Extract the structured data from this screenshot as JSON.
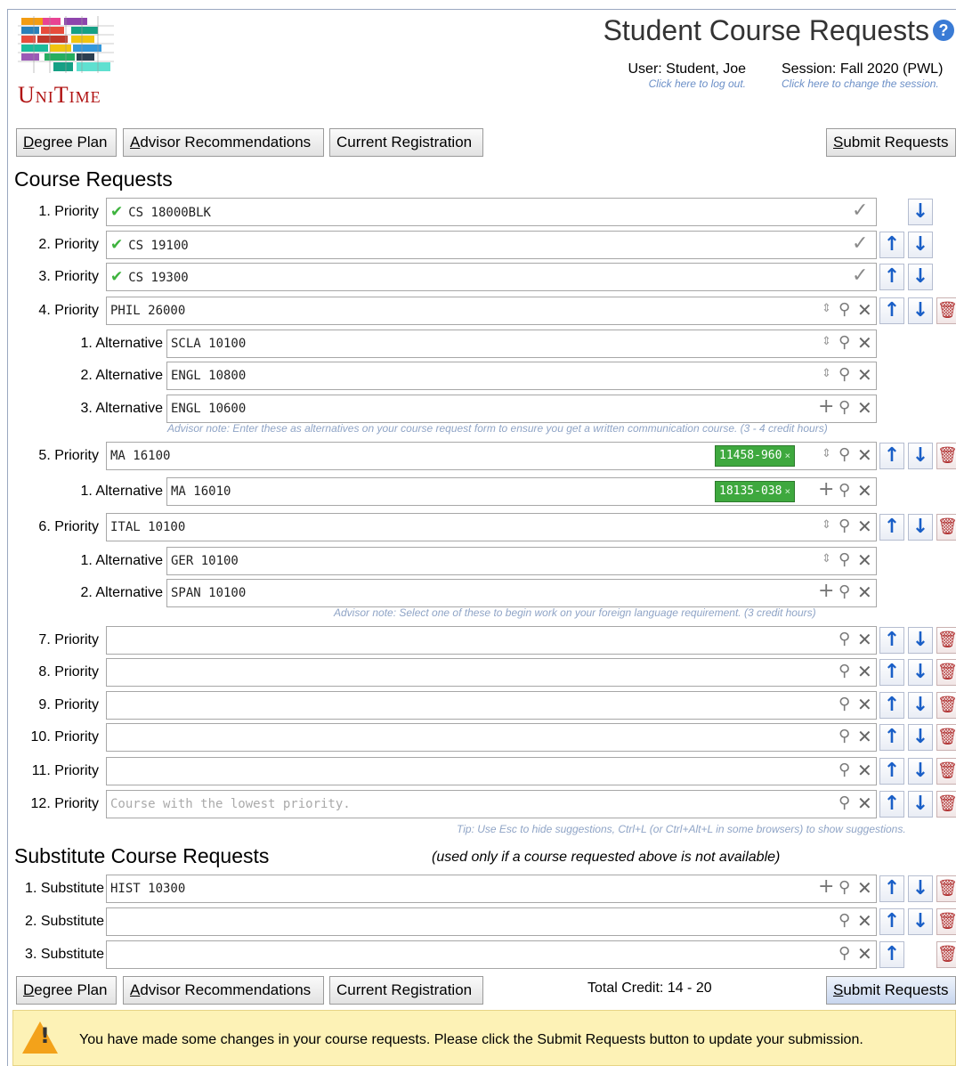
{
  "app": {
    "logo_text": "UniTime",
    "title": "Student Course Requests"
  },
  "header": {
    "user_label": "User: Student, Joe",
    "user_sub": "Click here to log out.",
    "session_label": "Session: Fall 2020 (PWL)",
    "session_sub": "Click here to change the session."
  },
  "toolbar": {
    "degree_plan": "Degree Plan",
    "advisor_recs": "Advisor Recommendations",
    "current_reg": "Current Registration",
    "submit": "Submit Requests"
  },
  "course_requests": {
    "title": "Course Requests",
    "rows": [
      {
        "label": "1. Priority",
        "value": "CS 18000BLK"
      },
      {
        "label": "2. Priority",
        "value": "CS 19100"
      },
      {
        "label": "3. Priority",
        "value": "CS 19300"
      },
      {
        "label": "4. Priority",
        "value": "PHIL 26000"
      },
      {
        "label": "1. Alternative",
        "value": "SCLA 10100"
      },
      {
        "label": "2. Alternative",
        "value": "ENGL 10800"
      },
      {
        "label": "3. Alternative",
        "value": "ENGL 10600"
      },
      {
        "label": "5. Priority",
        "value": "MA 16100",
        "chip": "11458-960"
      },
      {
        "label": "1. Alternative",
        "value": "MA 16010",
        "chip": "18135-038"
      },
      {
        "label": "6. Priority",
        "value": "ITAL 10100"
      },
      {
        "label": "1. Alternative",
        "value": "GER 10100"
      },
      {
        "label": "2. Alternative",
        "value": "SPAN 10100"
      },
      {
        "label": "7. Priority",
        "value": ""
      },
      {
        "label": "8. Priority",
        "value": ""
      },
      {
        "label": "9. Priority",
        "value": ""
      },
      {
        "label": "10. Priority",
        "value": ""
      },
      {
        "label": "11. Priority",
        "value": ""
      },
      {
        "label": "12. Priority",
        "value": "",
        "placeholder": "Course with the lowest priority."
      }
    ],
    "note_1": "Advisor note: Enter these as alternatives on your course request form to ensure you get a written communication course. (3 - 4 credit hours)",
    "note_2": "Advisor note: Select one of these to begin work on your foreign language requirement. (3 credit hours)",
    "tip": "Tip: Use Esc to hide suggestions, Ctrl+L (or Ctrl+Alt+L in some browsers) to show suggestions."
  },
  "substitutes": {
    "title": "Substitute Course Requests",
    "subtitle": "(used only if a course requested above is not available)",
    "rows": [
      {
        "label": "1. Substitute",
        "value": "HIST 10300"
      },
      {
        "label": "2. Substitute",
        "value": ""
      },
      {
        "label": "3. Substitute",
        "value": ""
      }
    ]
  },
  "footer": {
    "total_credit": "Total Credit: 14 - 20"
  },
  "warning": {
    "text": "You have made some changes in your course requests. Please click the Submit Requests button to update your submission."
  },
  "icons": [
    "help-icon",
    "check-icon",
    "sort-icon",
    "search-icon",
    "clear-icon",
    "add-icon",
    "move-up-icon",
    "move-down-icon",
    "delete-icon",
    "warning-icon"
  ]
}
